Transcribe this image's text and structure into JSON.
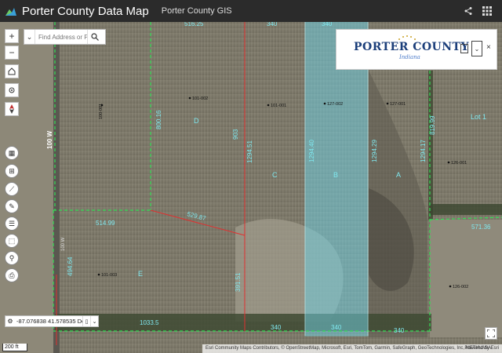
{
  "header": {
    "title": "Porter County Data Map",
    "subtitle": "Porter County GIS"
  },
  "search": {
    "placeholder": "Find Address or Parc..."
  },
  "county_logo": {
    "name": "PORTER COUNTY",
    "sub": "Indiana"
  },
  "coordinates": {
    "value": "-87.076838 41.578535 Degr..."
  },
  "scale": {
    "label": "200 ft"
  },
  "attribution": {
    "text": "Esri Community Maps Contributors, © OpenStreetMap, Microsoft, Esri, TomTom, Garmin, SafeGraph, GeoTechnologies, Inc, METI/NASA",
    "powered": "Powered by Esri"
  },
  "map_labels": {
    "road": "100 W",
    "dims": [
      "516.25",
      "340",
      "340",
      "800.16",
      "903",
      "1294.51",
      "1294.40",
      "1294.29",
      "1294.17",
      "819.99",
      "529.87",
      "514.99",
      "571.36",
      "494.64",
      "391.51",
      "1033.5",
      "340",
      "340",
      "340"
    ],
    "lots": [
      "D",
      "C",
      "B",
      "A",
      "E",
      "Lot 1"
    ],
    "parcels": [
      "100-001",
      "101-002",
      "101-001",
      "127-002",
      "127-001",
      "126-001",
      "101-003",
      "126-002"
    ]
  },
  "colors": {
    "header_bg": "#2b2b2b",
    "highlight": "#6fd3e6",
    "parcel_line": "#33dd55",
    "red_line": "#e03030",
    "dim_text": "#7fe8ef"
  }
}
